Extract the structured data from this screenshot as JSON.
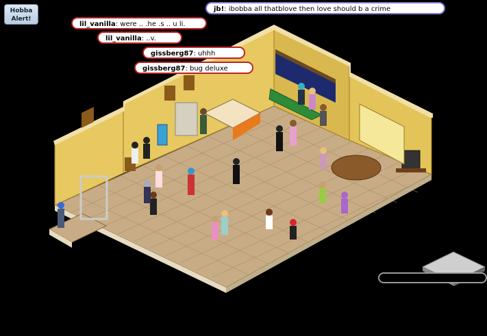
{
  "alert": {
    "line1": "Hobba",
    "line2": "Alert!"
  },
  "chat": [
    {
      "user": "jb!",
      "text": "ibobba all thatblove then love should b a crime",
      "style": "blue"
    },
    {
      "user": "lil_vanilla",
      "text": "were .. .he .s .. u li.",
      "style": "red"
    },
    {
      "user": "lil_vanilla",
      "text": "..v.",
      "style": "red"
    },
    {
      "user": "gissberg87",
      "text": "uhhh",
      "style": "red"
    },
    {
      "user": "gissberg87",
      "text": "bug deluxe",
      "style": "red"
    }
  ],
  "colors": {
    "floor": "#c8ac86",
    "floor_line": "#a88c66",
    "wall": "#e8c860",
    "wall_dark": "#c9a845",
    "wall_top": "#f0e0a8",
    "bubble_border": "#b22222",
    "bubble_blue": "#7b7bd6",
    "sofa": "#2e8b3a"
  },
  "icons": {
    "navigator": "tile-icon",
    "alert": "hobba-alert-icon"
  }
}
